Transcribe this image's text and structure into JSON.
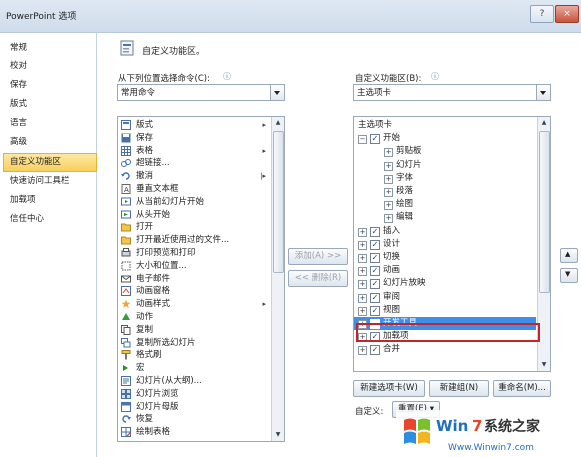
{
  "window": {
    "title": "PowerPoint 选项",
    "help_glyph": "?",
    "close_glyph": "×"
  },
  "sidebar": {
    "items": [
      "常规",
      "校对",
      "保存",
      "版式",
      "语言",
      "高级",
      "自定义功能区",
      "快速访问工具栏",
      "加载项",
      "信任中心"
    ],
    "selected_index": 6
  },
  "main": {
    "heading": "自定义功能区。",
    "left_label": "从下列位置选择命令(C):",
    "left_info": "ⓘ",
    "left_combo_value": "常用命令",
    "right_label": "自定义功能区(B):",
    "right_info": "ⓘ",
    "right_combo_value": "主选项卡",
    "commands": [
      {
        "text": "版式",
        "icon": "layout-icon",
        "arrow": "▸"
      },
      {
        "text": "保存",
        "icon": "save-icon",
        "arrow": ""
      },
      {
        "text": "表格",
        "icon": "table-icon",
        "arrow": "▸"
      },
      {
        "text": "超链接...",
        "icon": "hyperlink-icon",
        "arrow": ""
      },
      {
        "text": "撤消",
        "icon": "undo-icon",
        "arrow": "|▸"
      },
      {
        "text": "垂直文本框",
        "icon": "vertical-textbox-icon",
        "arrow": ""
      },
      {
        "text": "从当前幻灯片开始",
        "icon": "slideshow-current-icon",
        "arrow": ""
      },
      {
        "text": "从头开始",
        "icon": "slideshow-start-icon",
        "arrow": ""
      },
      {
        "text": "打开",
        "icon": "open-icon",
        "arrow": ""
      },
      {
        "text": "打开最近使用过的文件...",
        "icon": "recent-files-icon",
        "arrow": ""
      },
      {
        "text": "打印预览和打印",
        "icon": "print-preview-icon",
        "arrow": ""
      },
      {
        "text": "大小和位置...",
        "icon": "size-position-icon",
        "arrow": ""
      },
      {
        "text": "电子邮件",
        "icon": "email-icon",
        "arrow": ""
      },
      {
        "text": "动画窗格",
        "icon": "animation-pane-icon",
        "arrow": ""
      },
      {
        "text": "动画样式",
        "icon": "animation-style-icon",
        "arrow": "▸"
      },
      {
        "text": "动作",
        "icon": "action-icon",
        "arrow": ""
      },
      {
        "text": "复制",
        "icon": "copy-icon",
        "arrow": ""
      },
      {
        "text": "复制所选幻灯片",
        "icon": "duplicate-slide-icon",
        "arrow": ""
      },
      {
        "text": "格式刷",
        "icon": "format-painter-icon",
        "arrow": ""
      },
      {
        "text": "宏",
        "icon": "macro-icon",
        "arrow": ""
      },
      {
        "text": "幻灯片(从大纲)...",
        "icon": "slides-outline-icon",
        "arrow": ""
      },
      {
        "text": "幻灯片浏览",
        "icon": "slide-sorter-icon",
        "arrow": ""
      },
      {
        "text": "幻灯片母版",
        "icon": "slide-master-icon",
        "arrow": ""
      },
      {
        "text": "恢复",
        "icon": "redo-icon",
        "arrow": ""
      },
      {
        "text": "绘制表格",
        "icon": "draw-table-icon",
        "arrow": ""
      }
    ],
    "add_button": "添加(A) >>",
    "remove_button": "<< 删除(R)",
    "tree": [
      {
        "text": "主选项卡",
        "level": 0,
        "exp": "",
        "chk": false
      },
      {
        "text": "开始",
        "level": 1,
        "exp": "⊟",
        "chk": true
      },
      {
        "text": "剪贴板",
        "level": 2,
        "exp": "⊞",
        "chk": false
      },
      {
        "text": "幻灯片",
        "level": 2,
        "exp": "⊞",
        "chk": false
      },
      {
        "text": "字体",
        "level": 2,
        "exp": "⊞",
        "chk": false
      },
      {
        "text": "段落",
        "level": 2,
        "exp": "⊞",
        "chk": false
      },
      {
        "text": "绘图",
        "level": 2,
        "exp": "⊞",
        "chk": false
      },
      {
        "text": "编辑",
        "level": 2,
        "exp": "⊞",
        "chk": false
      },
      {
        "text": "插入",
        "level": 1,
        "exp": "⊞",
        "chk": true
      },
      {
        "text": "设计",
        "level": 1,
        "exp": "⊞",
        "chk": true
      },
      {
        "text": "切换",
        "level": 1,
        "exp": "⊞",
        "chk": true
      },
      {
        "text": "动画",
        "level": 1,
        "exp": "⊞",
        "chk": true
      },
      {
        "text": "幻灯片放映",
        "level": 1,
        "exp": "⊞",
        "chk": true
      },
      {
        "text": "审阅",
        "level": 1,
        "exp": "⊞",
        "chk": true
      },
      {
        "text": "视图",
        "level": 1,
        "exp": "⊞",
        "chk": true
      },
      {
        "text": "开发工具",
        "level": 1,
        "exp": "⊞",
        "chk": false,
        "selected": true
      },
      {
        "text": "加载项",
        "level": 1,
        "exp": "⊞",
        "chk": true
      },
      {
        "text": "合并",
        "level": 1,
        "exp": "⊞",
        "chk": true
      }
    ],
    "check_glyph": "✓",
    "new_tab_button": "新建选项卡(W)",
    "new_group_button": "新建组(N)",
    "rename_button": "重命名(M)...",
    "customize_label": "自定义:",
    "reset_button": "重置(E) ▾",
    "up_glyph": "▲",
    "down_glyph": "▼"
  },
  "watermark": {
    "brand_win": "Win",
    "brand_7": "7",
    "brand_rest": "系统之家",
    "url": "Www.Winwin7.com"
  },
  "colors": {
    "selected_nav": "#f8cf5c",
    "tree_selection": "#3f8ee8",
    "highlight_box": "#c0272d"
  }
}
